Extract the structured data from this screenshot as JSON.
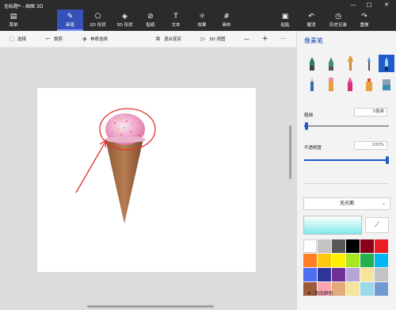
{
  "window": {
    "title": "无标题* - 画图 3D",
    "minimize": "—",
    "maximize": "□",
    "close": "✕"
  },
  "ribbon": {
    "tabs": [
      {
        "label": "菜单",
        "icon": "menu-icon"
      },
      {
        "label": "画笔",
        "icon": "brush-icon",
        "active": true
      },
      {
        "label": "2D 形状",
        "icon": "2d-shapes-icon"
      },
      {
        "label": "3D 形状",
        "icon": "3d-shapes-icon"
      },
      {
        "label": "贴纸",
        "icon": "stickers-icon"
      },
      {
        "label": "文本",
        "icon": "text-icon"
      },
      {
        "label": "效果",
        "icon": "effects-icon"
      },
      {
        "label": "画布",
        "icon": "canvas-icon"
      },
      {
        "label": "粘贴",
        "icon": "paste-icon"
      },
      {
        "label": "撤消",
        "icon": "undo-icon"
      },
      {
        "label": "历史记录",
        "icon": "history-icon"
      },
      {
        "label": "重做",
        "icon": "redo-icon"
      }
    ]
  },
  "toolbar": {
    "select": "选择",
    "crop": "裁剪",
    "magic_select": "神奇选择",
    "mixed_reality": "混合现实",
    "view_3d": "3D 视图",
    "zoom_out": "—",
    "zoom_in": "+",
    "more": "···"
  },
  "panel": {
    "title": "像素笔",
    "brushes": [
      "marker-icon",
      "calligraphy-pen-icon",
      "oil-brush-icon",
      "watercolor-icon",
      "pixel-pen-icon",
      "pencil-icon",
      "eraser-icon",
      "crayon-icon",
      "spray-can-icon",
      "fill-icon"
    ],
    "thickness_label": "粗细",
    "thickness_value": "5像素",
    "thickness_fraction": 0.03,
    "opacity_label": "不透明度",
    "opacity_value": "100%",
    "opacity_fraction": 1.0,
    "finish_value": "无光面",
    "current_color": "#7fe8e8",
    "palette": [
      "#ffffff",
      "#c3c3c3",
      "#585858",
      "#000000",
      "#88001b",
      "#ec1c24",
      "#ff7f27",
      "#ffc90e",
      "#fff200",
      "#a8e61d",
      "#22b14c",
      "#00b7ef",
      "#4d6df3",
      "#2f3699",
      "#6f3198",
      "#b5a5d5",
      "#f5e49c",
      "#c3c3c3",
      "#9c5a3c",
      "#ffa3b1",
      "#e5aa7a",
      "#f5e49c",
      "#99d9ea",
      "#709ad1"
    ],
    "add_color": "添加颜色"
  },
  "accents": {
    "ribbon_bg": "#2b2b2b",
    "active_tab": "#3651b8",
    "panel_accent": "#1f5bc9",
    "annotation_red": "#e0302c"
  }
}
